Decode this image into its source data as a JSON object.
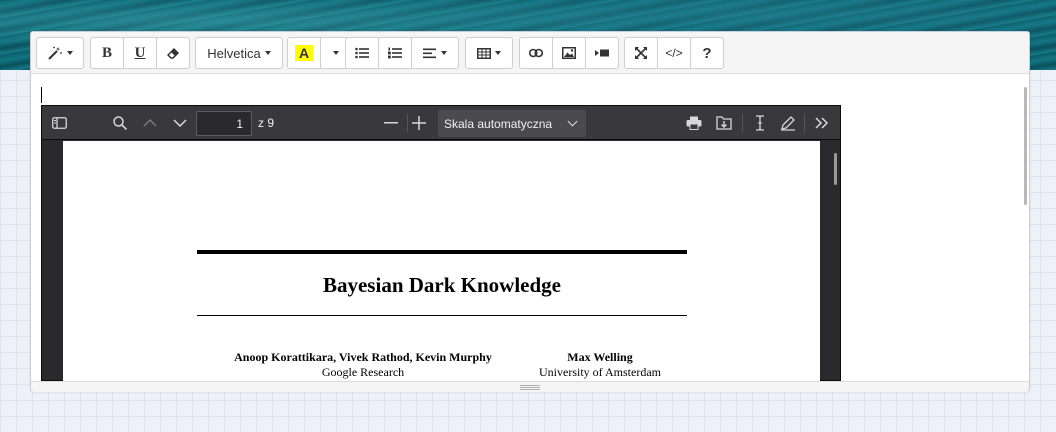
{
  "toolbar": {
    "font_name": "Helvetica",
    "bold_label": "B",
    "underline_label": "U",
    "highlight_label": "A",
    "code_label": "</>",
    "help_label": "?",
    "icons": [
      "magic-wand-icon",
      "eraser-icon",
      "bullet-list-icon",
      "numbered-list-icon",
      "align-icon",
      "table-icon",
      "link-icon",
      "image-icon",
      "video-icon",
      "fullscreen-icon"
    ]
  },
  "pdf_viewer": {
    "page_input": "1",
    "page_count": "z 9",
    "zoom": "Skala automatyczna"
  },
  "document": {
    "title": "Bayesian Dark Knowledge",
    "authors_left": "Anoop Korattikara, Vivek Rathod, Kevin Murphy",
    "affiliation_left": "Google Research",
    "authors_right": "Max Welling",
    "affiliation_right": "University of Amsterdam"
  },
  "colors": {
    "highlight": "#ffff00",
    "viewer_toolbar": "#38383d",
    "viewer_bg": "#2a2a2e"
  }
}
